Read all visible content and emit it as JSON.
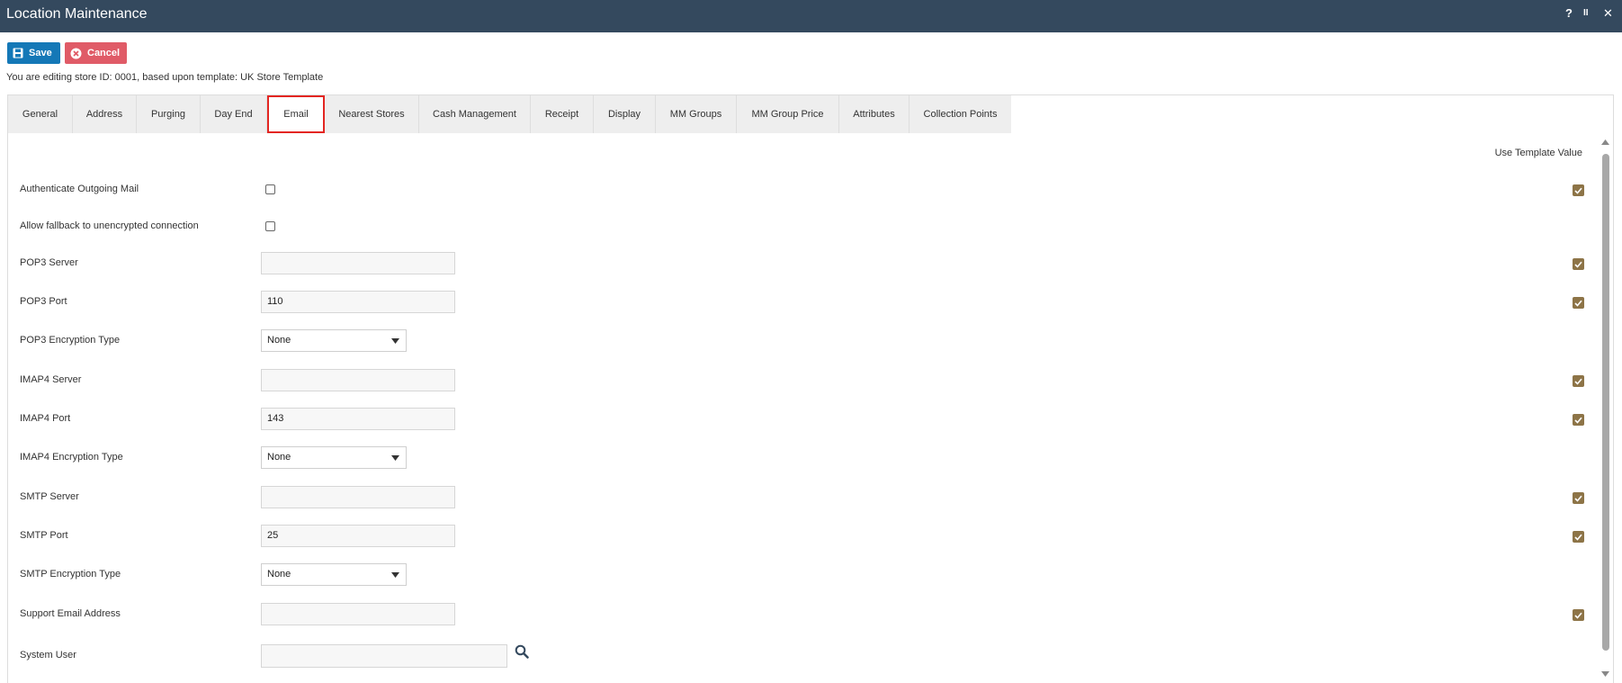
{
  "window": {
    "title": "Location Maintenance",
    "controls": {
      "help": "?",
      "pause": "II",
      "close": "✕"
    }
  },
  "toolbar": {
    "save_label": "Save",
    "cancel_label": "Cancel",
    "save_icon": "floppy-disk-icon",
    "cancel_icon": "x-circle-icon"
  },
  "info_text": "You are editing store ID: 0001, based upon template: UK Store Template",
  "tabs": [
    {
      "label": "General"
    },
    {
      "label": "Address"
    },
    {
      "label": "Purging"
    },
    {
      "label": "Day End"
    },
    {
      "label": "Email",
      "active": true
    },
    {
      "label": "Nearest Stores"
    },
    {
      "label": "Cash Management"
    },
    {
      "label": "Receipt"
    },
    {
      "label": "Display"
    },
    {
      "label": "MM Groups"
    },
    {
      "label": "MM Group Price"
    },
    {
      "label": "Attributes"
    },
    {
      "label": "Collection Points"
    }
  ],
  "form": {
    "use_template_header": "Use Template Value",
    "fields": [
      {
        "label": "Authenticate Outgoing Mail",
        "type": "checkbox",
        "checked": false,
        "template": true
      },
      {
        "label": "Allow fallback to unencrypted connection",
        "type": "checkbox",
        "checked": false,
        "template": false
      },
      {
        "label": "POP3 Server",
        "type": "text",
        "value": "",
        "template": true
      },
      {
        "label": "POP3 Port",
        "type": "text",
        "value": "110",
        "template": true
      },
      {
        "label": "POP3 Encryption Type",
        "type": "select",
        "value": "None",
        "template": false
      },
      {
        "label": "IMAP4 Server",
        "type": "text",
        "value": "",
        "template": true
      },
      {
        "label": "IMAP4 Port",
        "type": "text",
        "value": "143",
        "template": true
      },
      {
        "label": "IMAP4 Encryption Type",
        "type": "select",
        "value": "None",
        "template": false
      },
      {
        "label": "SMTP Server",
        "type": "text",
        "value": "",
        "template": true
      },
      {
        "label": "SMTP Port",
        "type": "text",
        "value": "25",
        "template": true
      },
      {
        "label": "SMTP Encryption Type",
        "type": "select",
        "value": "None",
        "template": false
      },
      {
        "label": "Support Email Address",
        "type": "text",
        "value": "",
        "template": true
      },
      {
        "label": "System User",
        "type": "lookup",
        "value": "",
        "template": false
      }
    ]
  },
  "colors": {
    "titlebar": "#34495e",
    "save": "#1478b7",
    "cancel": "#e05b67",
    "active_tab_border": "#e32622",
    "template_check": "#8d7447"
  }
}
